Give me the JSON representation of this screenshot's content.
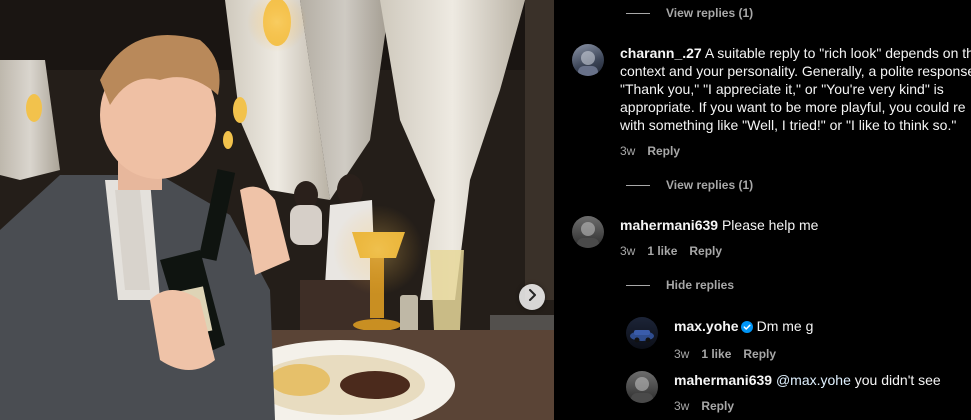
{
  "photo": {
    "next_icon": "chevron-right-icon"
  },
  "comments": {
    "view_replies_top": "View replies (1)",
    "c1": {
      "username": "charann_.27",
      "lines": [
        "A suitable reply to \"rich look\" depends on th",
        "context and your personality. Generally, a polite response",
        "\"Thank you,\" \"I appreciate it,\" or \"You're very kind\" is",
        "appropriate. If you want to be more playful, you could re",
        "with something like \"Well, I tried!\" or \"I like to think so.\""
      ],
      "time": "3w",
      "reply": "Reply",
      "view_replies": "View replies (1)"
    },
    "c2": {
      "username": "mahermani639",
      "text": "Please help me",
      "time": "3w",
      "likes": "1 like",
      "reply": "Reply",
      "hide_replies": "Hide replies"
    },
    "r1": {
      "username": "max.yohe",
      "text": "Dm me g",
      "time": "3w",
      "likes": "1 like",
      "reply": "Reply"
    },
    "r2": {
      "username": "mahermani639",
      "mention": "@max.yohe",
      "text": " you didn't see",
      "time": "3w",
      "reply": "Reply"
    }
  },
  "colors": {
    "background": "#000000",
    "text": "#f5f5f5",
    "secondary": "#a8a8a8",
    "verified": "#0095f6",
    "mention": "#e0f1ff"
  }
}
